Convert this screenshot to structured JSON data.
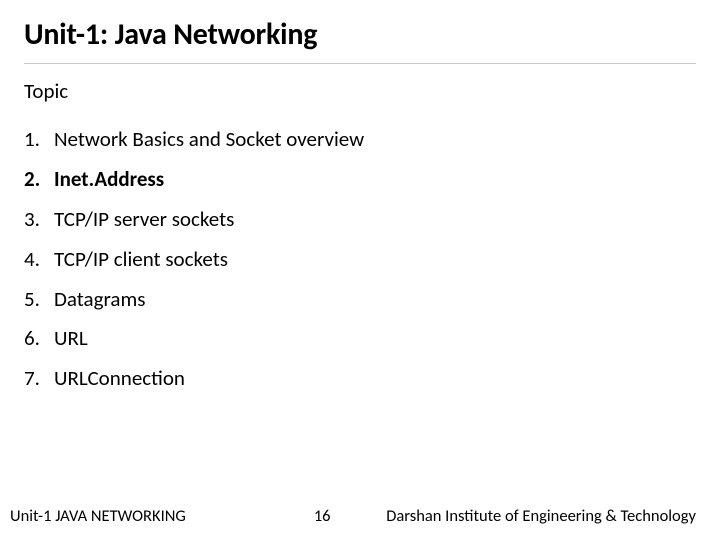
{
  "title": "Unit-1: Java Networking",
  "section_label": "Topic",
  "topics": [
    {
      "num": "1.",
      "text": "Network Basics and Socket overview",
      "highlight": false
    },
    {
      "num": "2.",
      "text": "Inet.Address",
      "highlight": true
    },
    {
      "num": "3.",
      "text": "TCP/IP server sockets",
      "highlight": false
    },
    {
      "num": "4.",
      "text": "TCP/IP client sockets",
      "highlight": false
    },
    {
      "num": "5.",
      "text": "Datagrams",
      "highlight": false
    },
    {
      "num": "6.",
      "text": "URL",
      "highlight": false
    },
    {
      "num": "7.",
      "text": "URLConnection",
      "highlight": false
    }
  ],
  "footer": {
    "left": "Unit-1 JAVA NETWORKING",
    "page": "16",
    "right": "Darshan Institute of Engineering & Technology"
  }
}
